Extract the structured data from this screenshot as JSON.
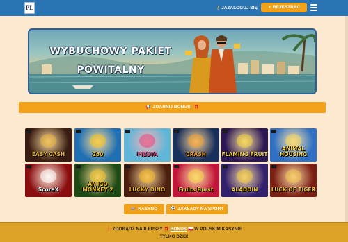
{
  "header": {
    "logo_text": "PL",
    "login_label": "JAZALOGUJ SIĘ",
    "register_label": "REJESTRAC"
  },
  "banner": {
    "title_line1": "WYBUCHOWY PAKIET",
    "title_line2": "POWITALNY"
  },
  "bonus_bar": {
    "label": "ZGARNIJ BONUS!"
  },
  "games": [
    {
      "name": "EASY CASH",
      "bg": "#3a1d12",
      "accent": "#e9b43a"
    },
    {
      "name": "250",
      "bg": "#1f6fb4",
      "accent": "#f4c21e"
    },
    {
      "name": "FIESTA",
      "bg": "#5fb6d8",
      "accent": "#e04682"
    },
    {
      "name": "CRASH",
      "bg": "#18305c",
      "accent": "#f0a02a"
    },
    {
      "name": "FLAMING FRUIT",
      "bg": "#2b1656",
      "accent": "#f2d13a"
    },
    {
      "name": "ANIMAL HOUSING",
      "bg": "#2f6fc4",
      "accent": "#f5d65a"
    },
    {
      "name": "ScoreX",
      "bg": "#8a0e10",
      "accent": "#ffffff"
    },
    {
      "name": "AMIGO MONKEY 2",
      "bg": "#1e4a16",
      "accent": "#f1c125"
    },
    {
      "name": "LUCKY DINO",
      "bg": "#4b1e0e",
      "accent": "#f2b41e"
    },
    {
      "name": "Fruits Burst",
      "bg": "#c2153a",
      "accent": "#f7d445"
    },
    {
      "name": "ALADDIN",
      "bg": "#33206d",
      "accent": "#f0c63d"
    },
    {
      "name": "LUCK OF TIGER",
      "bg": "#7b1e14",
      "accent": "#f3c24a"
    }
  ],
  "cta": {
    "casino_label": "KASYNO",
    "sport_label": "ZAKŁADY NA SPORT"
  },
  "promo": {
    "line1_prefix": "ZDOBĄDŹ NAJLEPSZY",
    "line1_highlight": "BONUS",
    "line1_suffix": "W POLSKIM KASYNIE",
    "line2": "TYLKO DZIŚ!"
  },
  "colors": {
    "header_bg": "#2a74b4",
    "accent_orange": "#f2a21a",
    "page_bg": "#fde9cf",
    "promo_bg": "#dca226"
  }
}
